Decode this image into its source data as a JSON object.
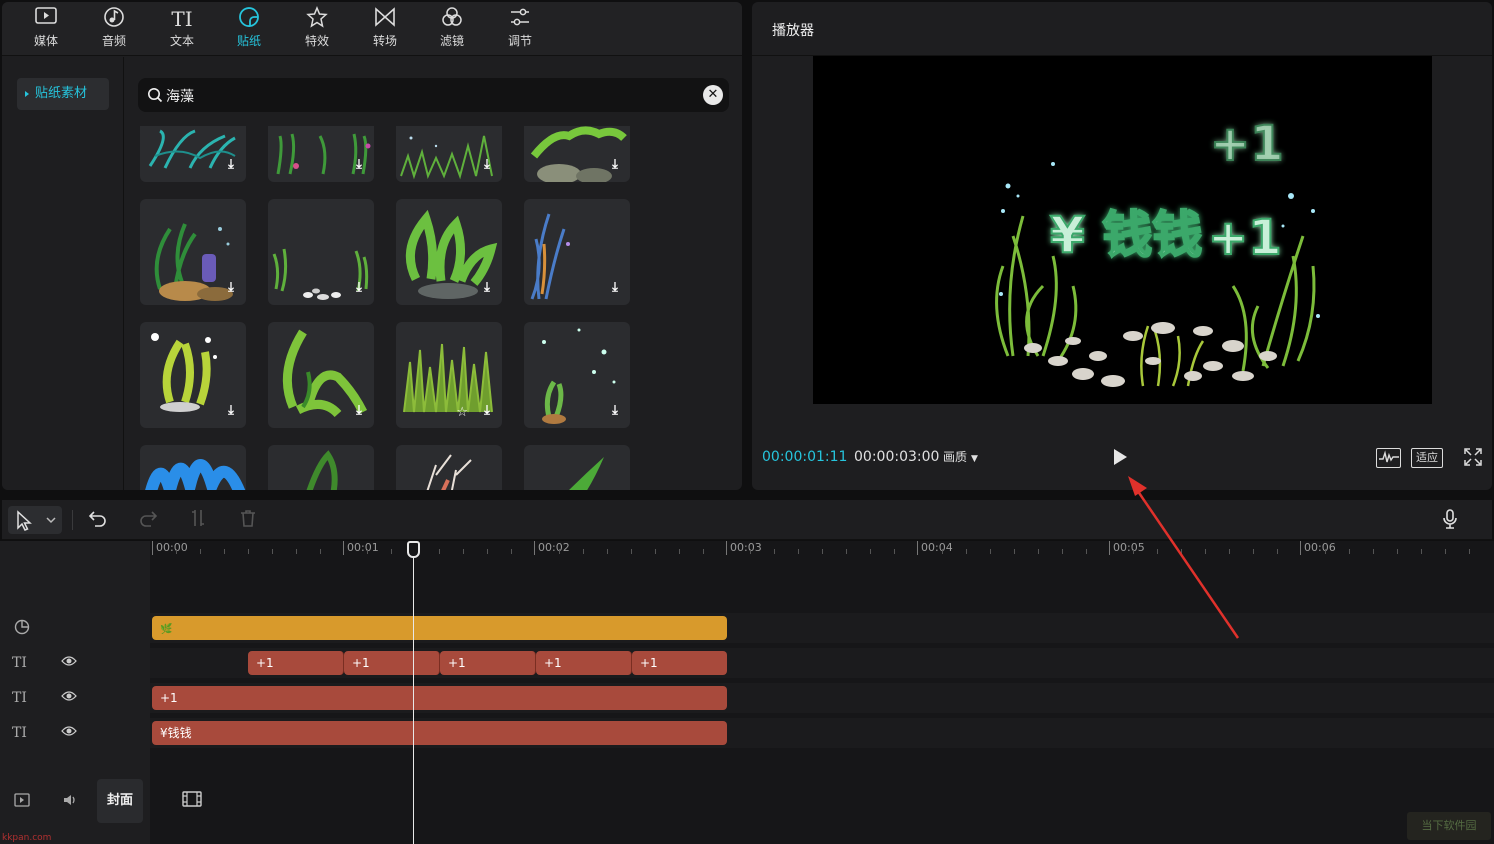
{
  "toolbar": {
    "items": [
      {
        "label": "媒体",
        "icon": "media-icon"
      },
      {
        "label": "音频",
        "icon": "audio-icon"
      },
      {
        "label": "文本",
        "icon": "text-icon"
      },
      {
        "label": "贴纸",
        "icon": "sticker-icon",
        "active": true
      },
      {
        "label": "特效",
        "icon": "effects-icon"
      },
      {
        "label": "转场",
        "icon": "transition-icon"
      },
      {
        "label": "滤镜",
        "icon": "filter-icon"
      },
      {
        "label": "调节",
        "icon": "adjust-icon"
      }
    ],
    "text_icon_glyph": "TI"
  },
  "sidebar": {
    "items": [
      {
        "label": "贴纸素材",
        "active": true
      }
    ]
  },
  "search": {
    "value": "海藻",
    "clear_glyph": "✕"
  },
  "stickers": {
    "download_glyph": "⤓",
    "favorite_glyph": "☆"
  },
  "player": {
    "title": "播放器",
    "current_time": "00:00:01:11",
    "total_time": "00:00:03:00",
    "quality_label": "画质",
    "fit_label": "适应",
    "preview": {
      "money_text": "¥ 钱钱",
      "plus_one": "+1"
    }
  },
  "timeline": {
    "ruler_labels": [
      "00:00",
      "00:01",
      "00:02",
      "00:03",
      "00:04",
      "00:05",
      "00:06"
    ],
    "playhead_time": "00:00:01:11",
    "tracks": [
      {
        "type": "sticker",
        "clips": [
          {
            "label": "🌿"
          }
        ]
      },
      {
        "type": "text",
        "clips": [
          {
            "label": "+1"
          },
          {
            "label": "+1"
          },
          {
            "label": "+1"
          },
          {
            "label": "+1"
          },
          {
            "label": "+1"
          }
        ]
      },
      {
        "type": "text",
        "clips": [
          {
            "label": "+1"
          }
        ]
      },
      {
        "type": "text",
        "clips": [
          {
            "label": "¥钱钱"
          }
        ]
      }
    ],
    "cover_label": "封面"
  },
  "watermark": {
    "text": "当下软件园",
    "site": "kkpan.com"
  },
  "colors": {
    "accent": "#26c4dc",
    "sticker_clip": "#d89a2c",
    "text_clip": "#a84a3c",
    "arrow": "#e0312b"
  }
}
